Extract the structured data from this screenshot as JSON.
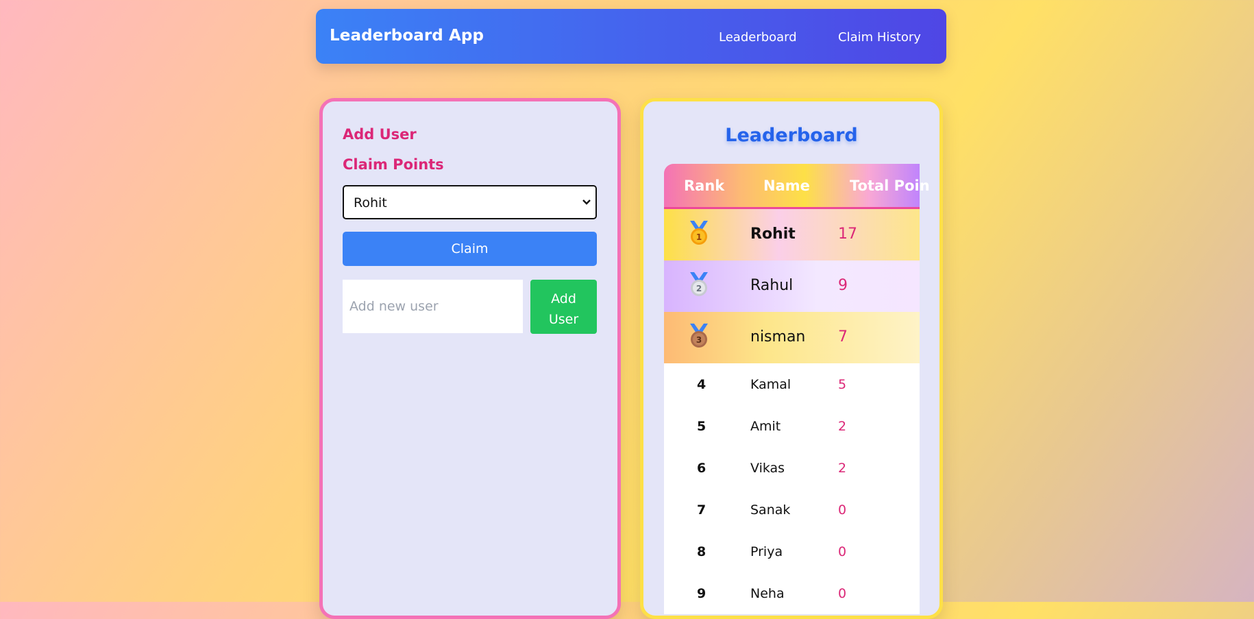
{
  "navbar": {
    "brand": "Leaderboard App",
    "links": [
      {
        "label": "Leaderboard"
      },
      {
        "label": "Claim History"
      }
    ]
  },
  "left_panel": {
    "add_user_heading": "Add User",
    "claim_points_heading": "Claim Points",
    "selected_user": "Rohit",
    "claim_button": "Claim",
    "new_user_placeholder": "Add new user",
    "add_user_button_line1": "Add",
    "add_user_button_line2": "User"
  },
  "leaderboard": {
    "title": "Leaderboard",
    "columns": {
      "rank": "Rank",
      "name": "Name",
      "points": "Total Poin"
    },
    "top_rows": [
      {
        "rank": "1",
        "name": "Rohit",
        "points": "17",
        "medal": "gold-medal-icon",
        "medal_color": "#f59e0b"
      },
      {
        "rank": "2",
        "name": "Rahul",
        "points": "9",
        "medal": "silver-medal-icon",
        "medal_color": "#d1d5db"
      },
      {
        "rank": "3",
        "name": "nisman",
        "points": "7",
        "medal": "bronze-medal-icon",
        "medal_color": "#c2825a"
      }
    ],
    "rows": [
      {
        "rank": "4",
        "name": "Kamal",
        "points": "5"
      },
      {
        "rank": "5",
        "name": "Amit",
        "points": "2"
      },
      {
        "rank": "6",
        "name": "Vikas",
        "points": "2"
      },
      {
        "rank": "7",
        "name": "Sanak",
        "points": "0"
      },
      {
        "rank": "8",
        "name": "Priya",
        "points": "0"
      },
      {
        "rank": "9",
        "name": "Neha",
        "points": "0"
      }
    ]
  },
  "colors": {
    "nav_gradient_start": "#3b82f6",
    "nav_gradient_end": "#4f46e5",
    "heading_pink": "#db2777",
    "claim_blue": "#3b82f6",
    "add_green": "#22c55e",
    "left_border": "#f472b6",
    "right_border": "#fde047"
  }
}
